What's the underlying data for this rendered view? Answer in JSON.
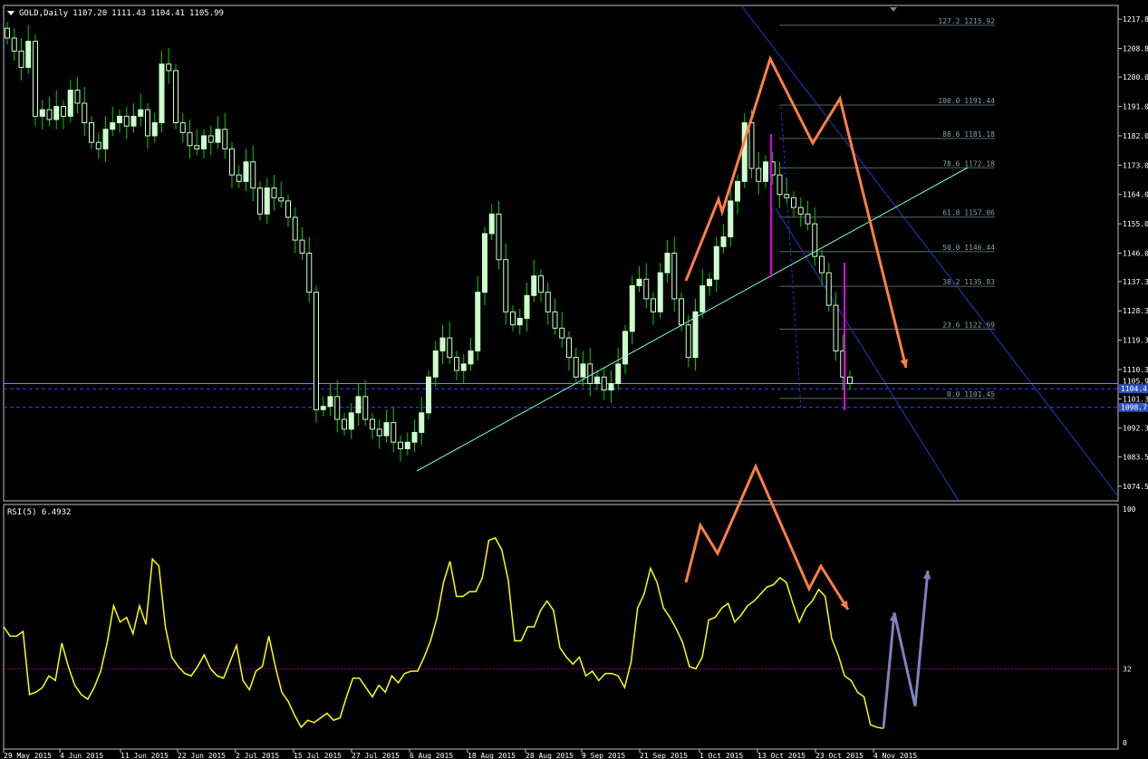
{
  "main_header": {
    "symbol": "GOLD,Daily",
    "open": "1107.20",
    "high": "1111.43",
    "low": "1104.41",
    "close": "1105.99"
  },
  "rsi_header": {
    "label": "RSI(5) 6.4932"
  },
  "colors": {
    "background": "#000000",
    "bull_candle": "#ccffcc",
    "wick": "#00cc00",
    "trendline": "#7fffd4",
    "channel": "#1e3cc8",
    "fib": "#556b6b",
    "arrow": "#ff8040",
    "rsi_line": "#ffff00",
    "rsi_level": "#800080",
    "magenta": "#e000e0",
    "projection": "#8080c0",
    "hline": "#4040ff",
    "price_tag": "#3050c0"
  },
  "chart_data": [
    {
      "type": "candlestick",
      "title": "GOLD,Daily",
      "ylim": [
        1070,
        1222
      ],
      "y_ticks": [
        "1217.8",
        "1208.8",
        "1200.0",
        "1191.0",
        "1182.0",
        "1173.0",
        "1164.0",
        "1155.0",
        "1146.0",
        "1137.3",
        "1128.3",
        "1119.3",
        "1110.3",
        "1101.3",
        "1092.3",
        "1083.5",
        "1074.5"
      ],
      "x_ticks": [
        "29 May 2015",
        "4 Jun 2015",
        "11 Jun 2015",
        "22 Jun 2015",
        "2 Jul 2015",
        "15 Jul 2015",
        "27 Jul 2015",
        "6 Aug 2015",
        "18 Aug 2015",
        "28 Aug 2015",
        "9 Sep 2015",
        "21 Sep 2015",
        "1 Oct 2015",
        "13 Oct 2015",
        "23 Oct 2015",
        "4 Nov 2015"
      ],
      "price_tags": [
        {
          "label": "1105.9",
          "value": 1105.99
        },
        {
          "label": "1104.4",
          "value": 1104.4
        },
        {
          "label": "1098.7",
          "value": 1098.7
        }
      ],
      "fib_levels": [
        {
          "label": "127.2  1215.92",
          "value": 1215.92
        },
        {
          "label": "100.0  1191.44",
          "value": 1191.44
        },
        {
          "label": "88.6  1181.18",
          "value": 1181.18
        },
        {
          "label": "78.6  1172.18",
          "value": 1172.18
        },
        {
          "label": "61.8  1157.06",
          "value": 1157.06
        },
        {
          "label": "50.0  1146.44",
          "value": 1146.44
        },
        {
          "label": "38.2  1135.83",
          "value": 1135.83
        },
        {
          "label": "23.6  1122.69",
          "value": 1122.69
        },
        {
          "label": "0.0  1101.45",
          "value": 1101.45
        }
      ],
      "closes": [
        1212,
        1208,
        1203,
        1211,
        1188,
        1190,
        1187,
        1191,
        1188,
        1196,
        1192,
        1186,
        1180,
        1178,
        1184,
        1186,
        1188,
        1185,
        1188,
        1190,
        1182,
        1186,
        1204,
        1202,
        1186,
        1183,
        1179,
        1178,
        1182,
        1180,
        1184,
        1178,
        1170,
        1168,
        1174,
        1166,
        1158,
        1166,
        1163,
        1162,
        1157,
        1150,
        1146,
        1134,
        1098,
        1099,
        1102,
        1095,
        1092,
        1097,
        1102,
        1095,
        1092,
        1090,
        1094,
        1088,
        1086,
        1088,
        1091,
        1097,
        1108,
        1116,
        1120,
        1114,
        1110,
        1112,
        1116,
        1134,
        1152,
        1158,
        1144,
        1128,
        1124,
        1126,
        1133,
        1139,
        1134,
        1128,
        1123,
        1120,
        1114,
        1108,
        1112,
        1106,
        1108,
        1104,
        1106,
        1112,
        1122,
        1136,
        1138,
        1132,
        1128,
        1140,
        1146,
        1132,
        1124,
        1114,
        1128,
        1136,
        1138,
        1148,
        1151,
        1162,
        1168,
        1186,
        1172,
        1168,
        1174,
        1170,
        1164,
        1163,
        1160,
        1158,
        1155,
        1145,
        1140,
        1130,
        1116,
        1108,
        1106
      ]
    },
    {
      "type": "line",
      "title": "RSI(5) 6.4932",
      "ylim": [
        0,
        100
      ],
      "y_ticks": [
        "100",
        "32",
        "0"
      ],
      "levels": [
        32
      ],
      "series": [
        {
          "name": "RSI(5)",
          "values": [
            50,
            46,
            46,
            48,
            21,
            22,
            24,
            29,
            27,
            43,
            33,
            25,
            21,
            19,
            24,
            31,
            43,
            59,
            52,
            54,
            47,
            59,
            51,
            79,
            76,
            50,
            37,
            33,
            30,
            29,
            33,
            38,
            32,
            29,
            28,
            35,
            42,
            27,
            23,
            31,
            33,
            46,
            33,
            22,
            18,
            12,
            7,
            10,
            9,
            11,
            13,
            10,
            11,
            20,
            28,
            28,
            24,
            20,
            25,
            22,
            29,
            26,
            30,
            31,
            31,
            37,
            44,
            54,
            69,
            78,
            63,
            63,
            65,
            65,
            71,
            87,
            88,
            83,
            70,
            44,
            44,
            50,
            50,
            57,
            61,
            57,
            41,
            37,
            34,
            37,
            29,
            31,
            27,
            30,
            30,
            29,
            24,
            35,
            58,
            64,
            75,
            69,
            58,
            54,
            49,
            43,
            33,
            32,
            37,
            53,
            54,
            58,
            60,
            52,
            55,
            59,
            61,
            64,
            67,
            68,
            71,
            69,
            60,
            52,
            58,
            61,
            66,
            63,
            45,
            38,
            29,
            27,
            22,
            20,
            8,
            7,
            6.49
          ]
        }
      ],
      "projection_arrow": [
        6.5,
        56,
        16,
        74
      ]
    }
  ]
}
